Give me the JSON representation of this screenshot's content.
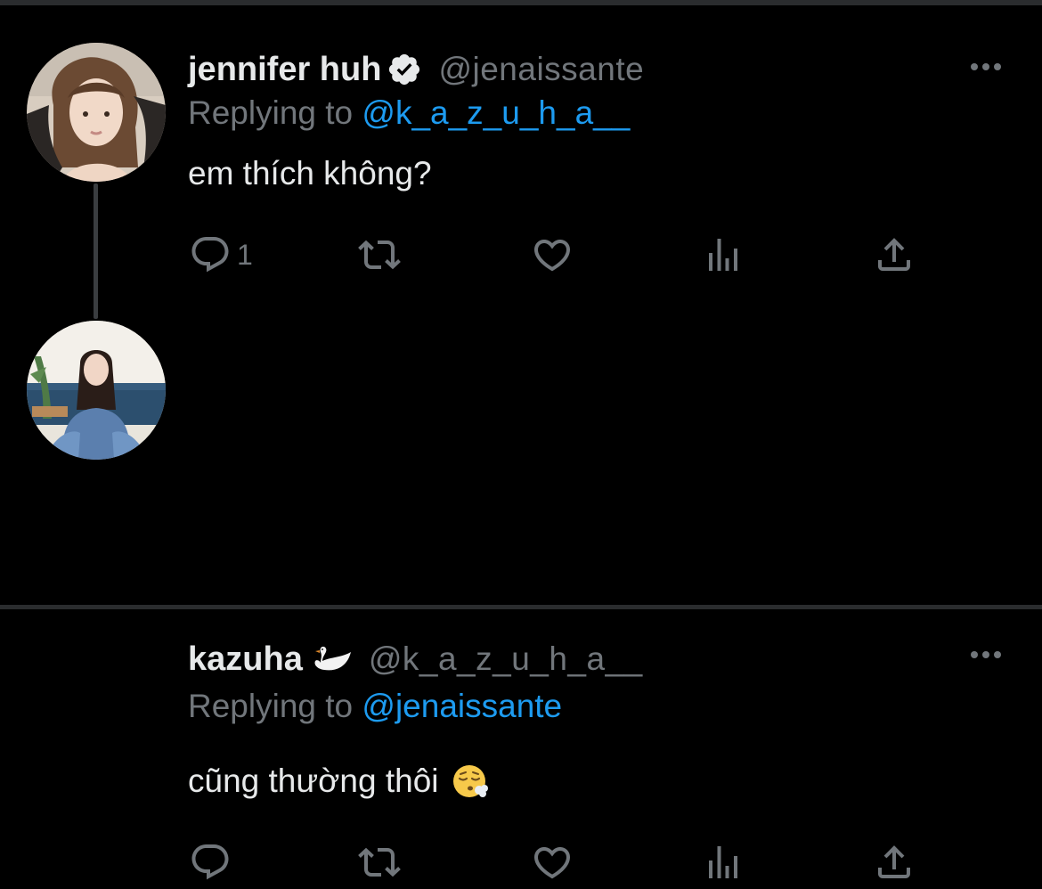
{
  "tweets": [
    {
      "author": {
        "display_name": "jennifer huh",
        "handle": "@jenaissante",
        "verified": true,
        "avatar": "profile-photo"
      },
      "replying_to_prefix": "Replying to",
      "replying_to": "@k_a_z_u_h_a__",
      "text": "em thích không?",
      "actions": {
        "reply_icon": "reply-icon",
        "reply_count": "1",
        "retweet_icon": "retweet-icon",
        "like_icon": "heart-icon",
        "views_icon": "analytics-icon",
        "share_icon": "share-icon"
      },
      "more_icon": "more-icon"
    },
    {
      "author": {
        "display_name": "kazuha",
        "name_emoji": "swan-emoji",
        "handle": "@k_a_z_u_h_a__",
        "verified": false,
        "avatar": "profile-photo"
      },
      "replying_to_prefix": "Replying to",
      "replying_to": "@jenaissante",
      "text": "cũng thường thôi",
      "text_emoji": "face-exhaling-emoji",
      "actions": {
        "reply_icon": "reply-icon",
        "reply_count": "",
        "retweet_icon": "retweet-icon",
        "like_icon": "heart-icon",
        "views_icon": "analytics-icon",
        "share_icon": "share-icon"
      },
      "more_icon": "more-icon"
    }
  ],
  "colors": {
    "background": "#000000",
    "text_primary": "#e7e9ea",
    "text_secondary": "#71767b",
    "link": "#1d9bf0",
    "thread_line": "#3a3d40"
  }
}
